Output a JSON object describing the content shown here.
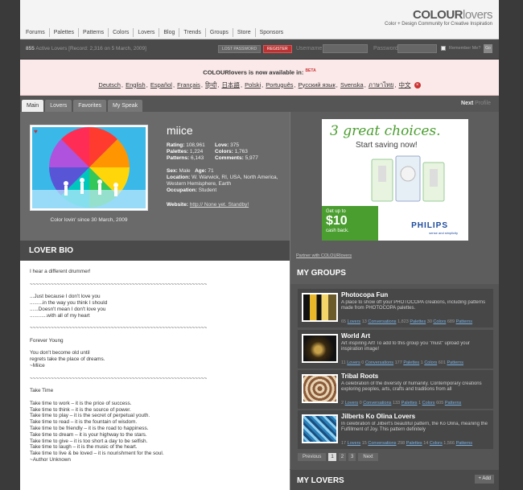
{
  "site": {
    "logo_bold": "COLOUR",
    "logo_thin": "lovers",
    "tagline": "Color + Design Community for Creative Inspiration"
  },
  "nav": [
    "Forums",
    "Palettes",
    "Patterns",
    "Colors",
    "Lovers",
    "Blog",
    "Trends",
    "Groups",
    "Store",
    "Sponsors"
  ],
  "loginbar": {
    "active_count": "855",
    "active_text": "Active Lovers [Record: 2,316 on 5 March, 2009]",
    "lost_password": "Lost Password",
    "register": "Register",
    "username_label": "Username",
    "password_label": "Password",
    "remember": "Remember Me?",
    "go": "Go"
  },
  "languages": {
    "message": "COLOURlovers is now available in:",
    "beta": "BETA",
    "list": [
      "Deutsch",
      "English",
      "Español",
      "Français",
      "हिन्दी",
      "日本語",
      "Polski",
      "Português",
      "Русский язык",
      "Svenska",
      "ภาษาไทย",
      "中文"
    ],
    "close": "×"
  },
  "tabs": [
    {
      "label": "Main",
      "active": true
    },
    {
      "label": "Lovers",
      "active": false
    },
    {
      "label": "Favorites",
      "active": false
    },
    {
      "label": "My Speak",
      "active": false
    }
  ],
  "profile_nav": {
    "next": "Next",
    "profile": "Profile"
  },
  "profile": {
    "username": "miice",
    "since": "Color lovin' since 30 March, 2009",
    "rating_label": "Rating:",
    "rating": "108,961",
    "love_label": "Love:",
    "love": "375",
    "palettes_label": "Palettes:",
    "palettes": "1,224",
    "colors_label": "Colors:",
    "colors": "1,763",
    "patterns_label": "Patterns:",
    "patterns": "6,143",
    "comments_label": "Comments:",
    "comments": "5,977",
    "sex_label": "Sex:",
    "sex": "Male",
    "age_label": "Age:",
    "age": "71",
    "location_label": "Location:",
    "location": "W. Warwick, RI, USA, North America, Western Hemisphere, Earth",
    "occupation_label": "Occupation:",
    "occupation": "Student",
    "website_label": "Website:",
    "website": "http:// None yet. Standby!"
  },
  "ad": {
    "headline": "3 great choices.",
    "subhead": "Start saving now!",
    "cash_small": "Get up to",
    "cash_big": "$10",
    "cash_tail": "cash back.",
    "brand": "PHILIPS",
    "brand_tag": "sense and simplicity",
    "partner": "Partner with COLOURlovers"
  },
  "bio": {
    "title": "LOVER BIO",
    "text": "I hear a different drummer!\n\n~~~~~~~~~~~~~~~~~~~~~~~~~~~~~~~~~~~~~~~~~~~~~~~~~~~~~~~~~~~\n\n...Just because I don't love you\n.........in the way you think I should\n......Doesn't mean I don't love you\n............with all of my heart\n\n~~~~~~~~~~~~~~~~~~~~~~~~~~~~~~~~~~~~~~~~~~~~~~~~~~~~~~~~~~~\n\nForever Young\n\nYou don't become old until\nregrets take the place of dreams.\n~Miice\n\n~~~~~~~~~~~~~~~~~~~~~~~~~~~~~~~~~~~~~~~~~~~~~~~~~~~~~~~~~~~\n\nTake Time\n\nTake time to work – it is the price of success.\nTake time to think – it is the source of power.\nTake time to play – it is the secret of perpetual youth.\nTake time to read – it is the fountain of wisdom.\nTake time to be friendly – it is the road to happiness.\nTake time to dream – it is your highway to the stars.\nTake time to give – it is too short a day to be selfish.\nTake time to laugh – it is the music of the heart.\nTake time to live & be loved – it is nourishment for the soul.\n~Author Unknown"
  },
  "groups": {
    "title": "MY GROUPS",
    "items": [
      {
        "title": "Photocopa Fun",
        "desc": "A place to show off your PHOTOCOPA creations, including patterns made from PHOTOCOPA palettes.",
        "lovers": "65",
        "conversations": "13",
        "palettes": "1,823",
        "colors": "30",
        "patterns": "689"
      },
      {
        "title": "World Art",
        "desc": "Art inspiring Art! To add to this group you \"must\" upload your inspiration image!",
        "lovers": "11",
        "conversations": "0",
        "palettes": "177",
        "colors": "1",
        "patterns": "601"
      },
      {
        "title": "Tribal Roots",
        "desc": "A celebration of the diversity of humanity. Contemporary creations exploring peoples, arts, crafts and traditions from all",
        "lovers": "2",
        "conversations": "0",
        "palettes": "133",
        "colors": "1",
        "patterns": "605"
      },
      {
        "title": "Jilberts Ko Olina Lovers",
        "desc": "In celebration of Jilbert's beautiful pattern, the Ko Olina, meaning the Fulfillment of Joy. This pattern definitely",
        "lovers": "17",
        "conversations": "15",
        "palettes": "298",
        "colors": "14",
        "patterns": "1,566"
      }
    ],
    "labels": {
      "lovers": "Lovers",
      "conversations": "Conversations",
      "palettes": "Palettes",
      "colors": "Colors",
      "patterns": "Patterns"
    },
    "pager": {
      "previous": "Previous",
      "pages": [
        "1",
        "2",
        "3"
      ],
      "next": "Next"
    }
  },
  "my_lovers": {
    "title": "MY LOVERS",
    "add": "+ Add"
  },
  "colors": {
    "accent_green": "#4a9e2f",
    "register_red": "#bb3333",
    "link_blue": "#7ab0e0"
  }
}
